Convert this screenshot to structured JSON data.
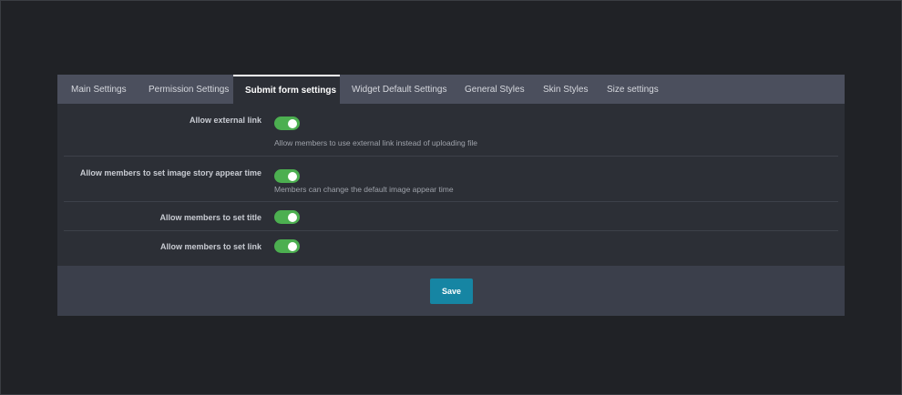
{
  "tabs": [
    {
      "label": "Main Settings",
      "active": false
    },
    {
      "label": "Permission Settings",
      "active": false
    },
    {
      "label": "Submit form settings",
      "active": true
    },
    {
      "label": "Widget Default Settings",
      "active": false
    },
    {
      "label": "General Styles",
      "active": false
    },
    {
      "label": "Skin Styles",
      "active": false
    },
    {
      "label": "Size settings",
      "active": false
    }
  ],
  "settings": [
    {
      "label": "Allow external link",
      "enabled": true,
      "description": "Allow members to use external link instead of uploading file"
    },
    {
      "label": "Allow members to set image story appear time",
      "enabled": true,
      "description": "Members can change the default image appear time"
    },
    {
      "label": "Allow members to set title",
      "enabled": true
    },
    {
      "label": "Allow members to set link",
      "enabled": true
    }
  ],
  "footer": {
    "save_label": "Save"
  },
  "colors": {
    "background": "#202226",
    "panel": "#2c2f36",
    "tab_bar": "#4b4f5d",
    "toggle_on": "#4caf50",
    "save_button": "#1685a3"
  }
}
